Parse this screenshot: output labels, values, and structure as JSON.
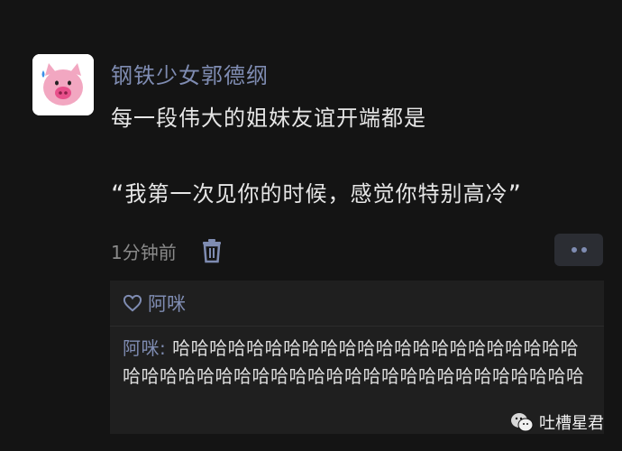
{
  "post": {
    "username": "钢铁少女郭德纲",
    "text": "每一段伟大的姐妹友谊开端都是\n\n“我第一次见你的时候，感觉你特别高冷”",
    "time": "1分钟前"
  },
  "likes": {
    "names": "阿咪"
  },
  "comment": {
    "author": "阿咪:",
    "text": "哈哈哈哈哈哈哈哈哈哈哈哈哈哈哈哈哈哈哈哈哈哈哈哈哈哈哈哈哈哈哈哈哈哈哈哈哈哈哈哈哈哈哈哈哈哈哈"
  },
  "watermark": {
    "text": "吐槽星君"
  },
  "colors": {
    "background": "#141414",
    "name_link": "#7f8cb2",
    "panel": "#1f1f1f"
  },
  "icons": {
    "avatar": "pig-avatar",
    "delete": "trash-icon",
    "more": "more-dots-icon",
    "like": "heart-outline-icon",
    "watermark": "wechat-official-account-icon"
  }
}
